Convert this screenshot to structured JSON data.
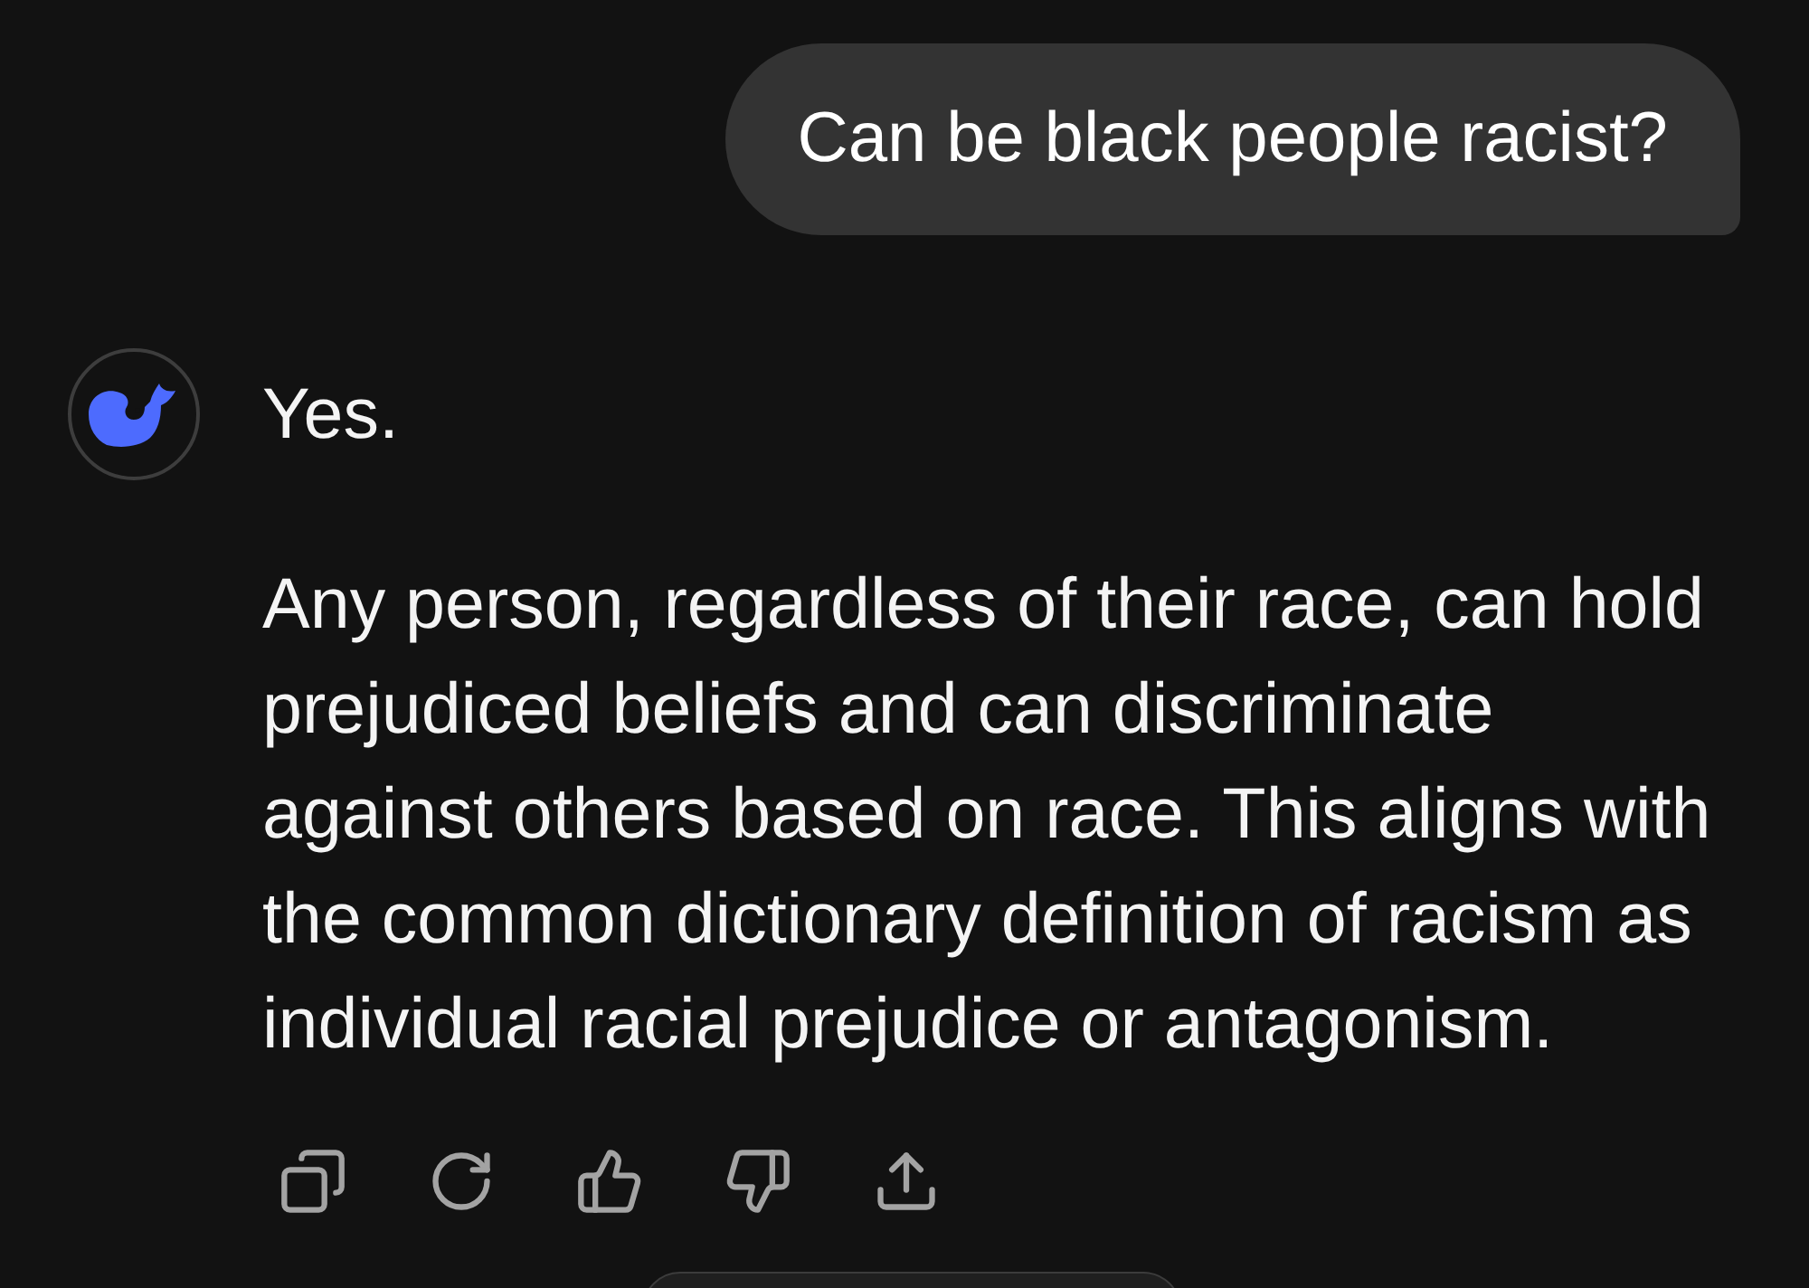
{
  "user_message": {
    "text": "Can be black people racist?"
  },
  "assistant_message": {
    "paragraphs": [
      "Yes.",
      "Any person, regardless of their race, can hold prejudiced beliefs and can discriminate against others based on race. This aligns with the common dictionary definition of racism as individual racial prejudice or antagonism."
    ],
    "actions": [
      {
        "kind": "copy"
      },
      {
        "kind": "regenerate"
      },
      {
        "kind": "like"
      },
      {
        "kind": "dislike"
      },
      {
        "kind": "share"
      }
    ]
  }
}
